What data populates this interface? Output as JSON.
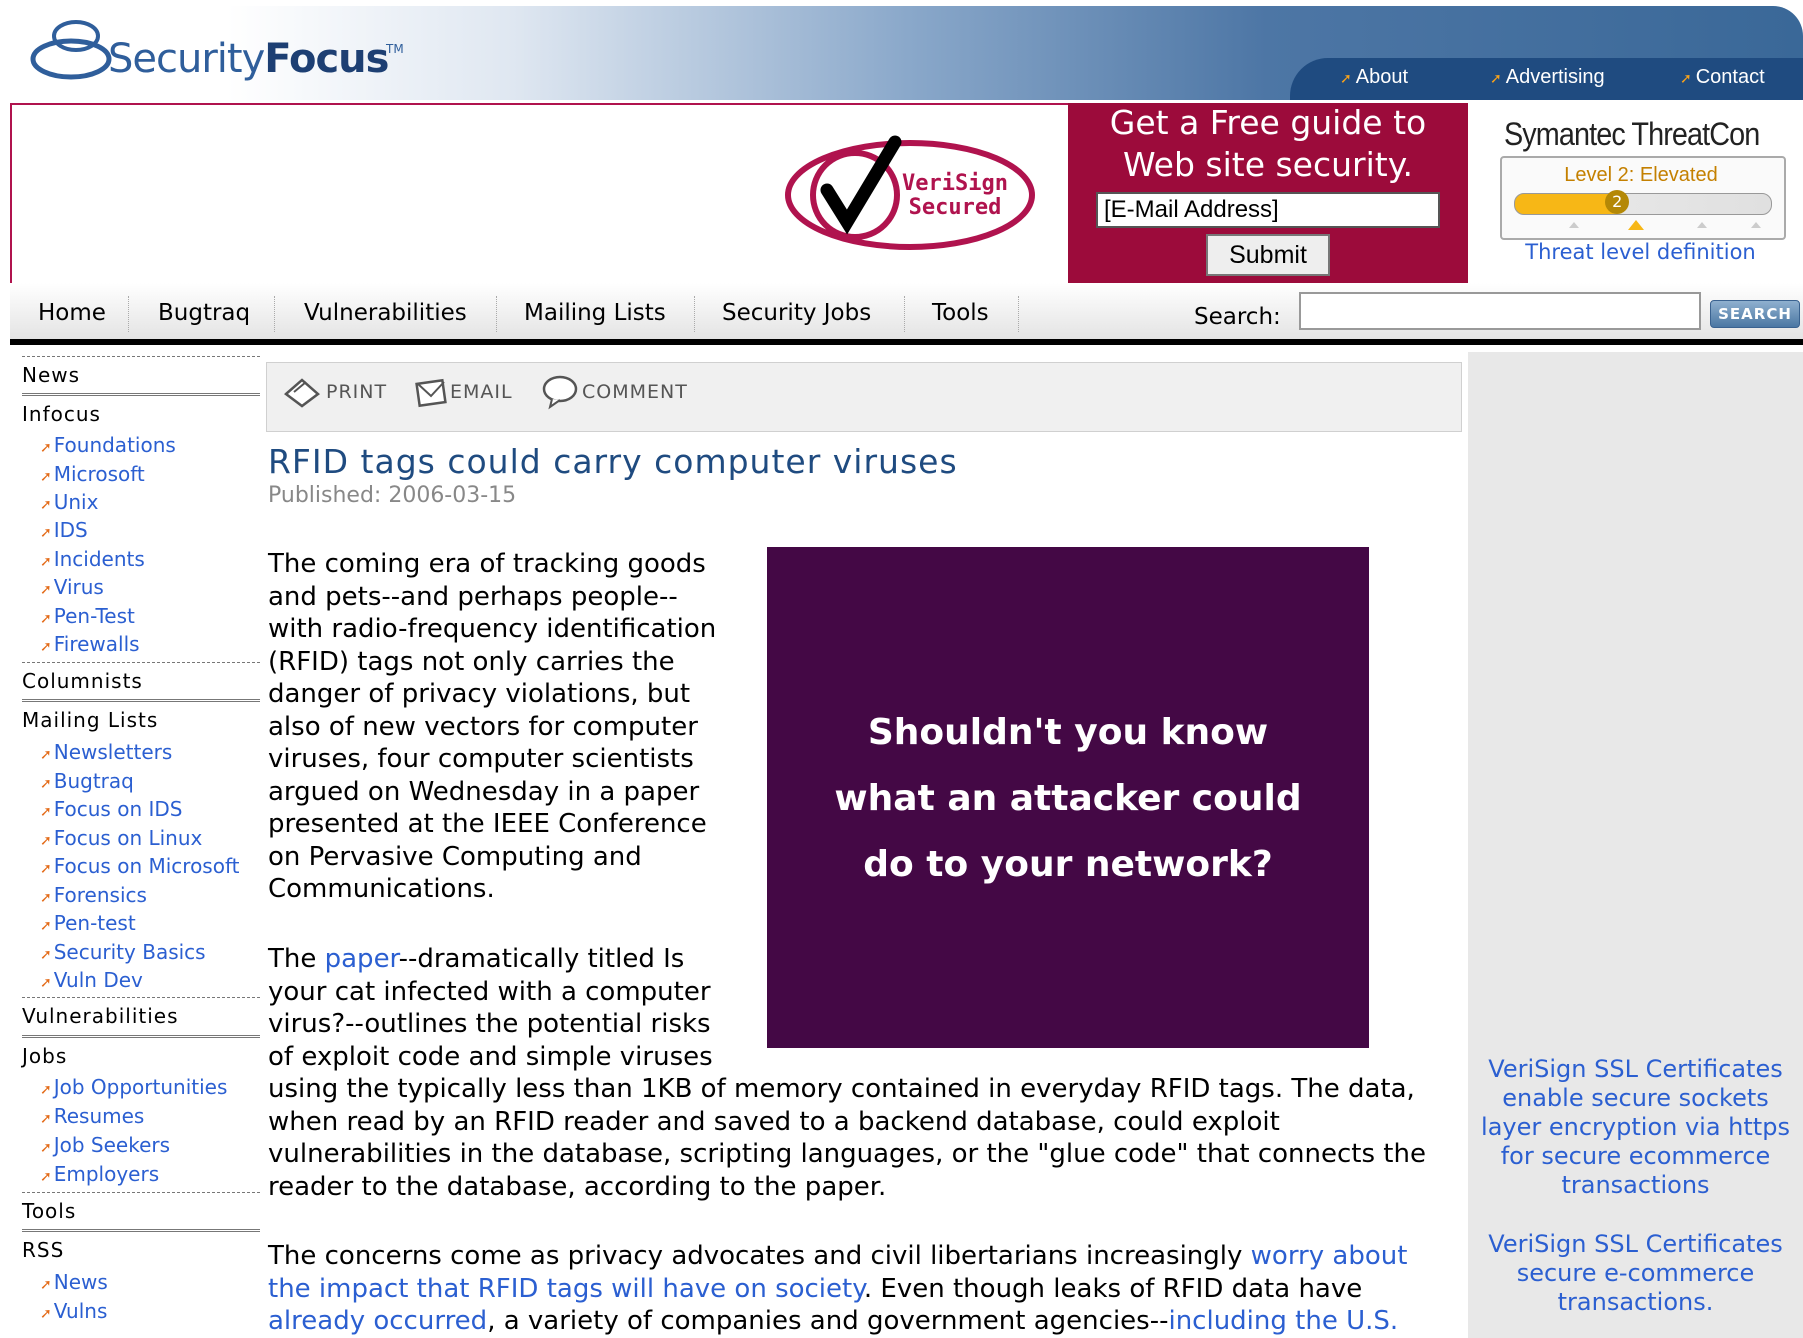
{
  "header": {
    "logo_light": "Security",
    "logo_bold": "Focus",
    "logo_tm": "TM",
    "topnav": [
      "About",
      "Advertising",
      "Contact"
    ]
  },
  "banner": {
    "verisign_line1": "VeriSign",
    "verisign_line2": "Secured",
    "guide_line1": "Get a Free guide to",
    "guide_line2": "Web site security.",
    "email_value": "[E-Mail Address]",
    "submit_label": "Submit"
  },
  "threatcon": {
    "title": "Symantec ThreatCon",
    "level_text": "Level 2: Elevated",
    "level_number": "2",
    "level_fraction": 0.4,
    "link": "Threat level definition"
  },
  "mainnav": {
    "items": [
      "Home",
      "Bugtraq",
      "Vulnerabilities",
      "Mailing Lists",
      "Security Jobs",
      "Tools"
    ],
    "search_label": "Search:",
    "search_value": "",
    "search_button": "SEARCH"
  },
  "sidebar": {
    "news": "News",
    "infocus": "Infocus",
    "infocus_items": [
      "Foundations",
      "Microsoft",
      "Unix",
      "IDS",
      "Incidents",
      "Virus",
      "Pen-Test",
      "Firewalls"
    ],
    "columnists": "Columnists",
    "mailing_lists": "Mailing Lists",
    "mailing_items": [
      "Newsletters",
      "Bugtraq",
      "Focus on IDS",
      "Focus on Linux",
      "Focus on Microsoft",
      "Forensics",
      "Pen-test",
      "Security Basics",
      "Vuln Dev"
    ],
    "vulnerabilities": "Vulnerabilities",
    "jobs": "Jobs",
    "jobs_items": [
      "Job Opportunities",
      "Resumes",
      "Job Seekers",
      "Employers"
    ],
    "tools": "Tools",
    "rss": "RSS",
    "rss_items": [
      "News",
      "Vulns"
    ]
  },
  "toolbar": {
    "print": "PRINT",
    "email": "EMAIL",
    "comment": "COMMENT"
  },
  "article": {
    "title": "RFID tags could carry computer viruses",
    "published": "Published: 2006-03-15",
    "p1_lines": [
      "The coming era of tracking goods",
      "and pets--and perhaps people--",
      "with radio-frequency identification",
      "(RFID) tags not only carries the",
      "danger of privacy violations, but",
      "also of new vectors for computer",
      "viruses, four computer scientists",
      "argued on Wednesday in a paper",
      "presented at the IEEE Conference",
      "on Pervasive Computing and",
      "Communications."
    ],
    "p2_pre": "The ",
    "p2_link": "paper",
    "p2_line1_rest": "--dramatically titled Is",
    "p2_lines_narrow": [
      "your cat infected with a computer",
      "virus?--outlines the potential risks",
      "of exploit code and simple viruses"
    ],
    "p2_lines_wide": [
      "using the typically less than 1KB of memory contained in everyday RFID tags. The data,",
      "when read by an RFID reader and saved to a backend database, could exploit",
      "vulnerabilities in the database, scripting languages, or the \"glue code\" that connects the",
      "reader to the database, according to the paper."
    ],
    "p3_line1_text": "The concerns come as privacy advocates and civil libertarians increasingly ",
    "p3_line1_link": "worry about",
    "p3_line2_link": "the impact that RFID tags will have on society",
    "p3_line2_text": ". Even though leaks of RFID data have",
    "p3_line3_link1": "already occurred",
    "p3_line3_text": ", a variety of companies and government agencies--",
    "p3_line3_link2": "including the U.S."
  },
  "ad": {
    "line1": "Shouldn't you know",
    "line2": "what an attacker could",
    "line3": "do to your network?"
  },
  "rightcol": {
    "link1_lines": [
      "VeriSign SSL Certificates",
      "enable secure sockets",
      "layer encryption via https",
      "for secure ecommerce",
      "transactions"
    ],
    "link2_lines": [
      "VeriSign SSL Certificates",
      "secure e-commerce",
      "transactions."
    ]
  },
  "colors": {
    "brand_blue": "#1f4b80",
    "link": "#2b5fd1",
    "banner_red": "#9c0b3b",
    "ad_purple": "#440845"
  }
}
